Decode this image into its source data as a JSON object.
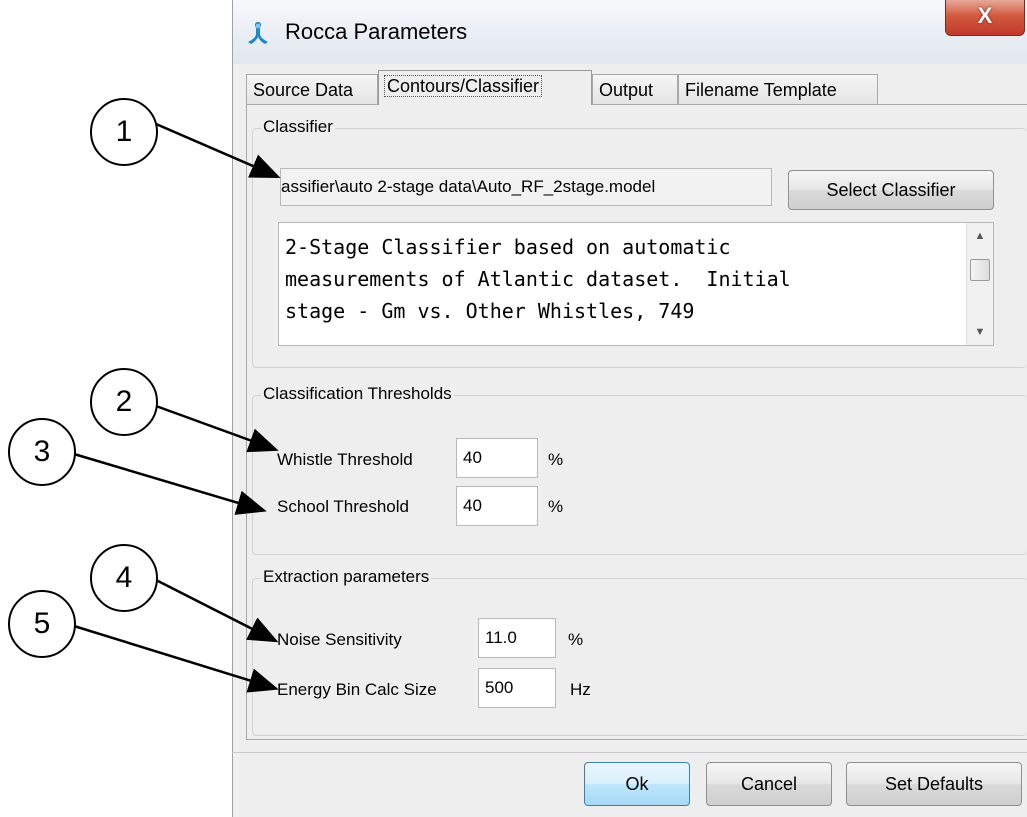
{
  "window": {
    "title": "Rocca Parameters",
    "close_label": "X",
    "icon": "rocca-app-icon"
  },
  "tabs": [
    {
      "label": "Source Data",
      "active": false
    },
    {
      "label": "Contours/Classifier",
      "active": true
    },
    {
      "label": "Output",
      "active": false
    },
    {
      "label": "Filename Template",
      "active": false
    }
  ],
  "classifier": {
    "group_title": "Classifier",
    "path_value": "assifier\\auto 2-stage data\\Auto_RF_2stage.model",
    "select_button": "Select Classifier",
    "description_lines": [
      "2-Stage Classifier based on automatic",
      "measurements of Atlantic dataset.  Initial",
      "stage - Gm vs. Other Whistles, 749"
    ]
  },
  "thresholds": {
    "group_title": "Classification Thresholds",
    "whistle_label": "Whistle Threshold",
    "whistle_value": "40",
    "whistle_unit": "%",
    "school_label": "School Threshold",
    "school_value": "40",
    "school_unit": "%"
  },
  "extraction": {
    "group_title": "Extraction parameters",
    "noise_label": "Noise Sensitivity",
    "noise_value": "11.0",
    "noise_unit": "%",
    "energy_label": "Energy Bin Calc Size",
    "energy_value": "500",
    "energy_unit": "Hz"
  },
  "footer": {
    "ok": "Ok",
    "cancel": "Cancel",
    "defaults": "Set Defaults"
  },
  "callouts": [
    "1",
    "2",
    "3",
    "4",
    "5"
  ],
  "colors": {
    "accent_ok": "#3c7fb1",
    "close_button": "#c0392b",
    "panel_bg": "#eeeeee"
  }
}
